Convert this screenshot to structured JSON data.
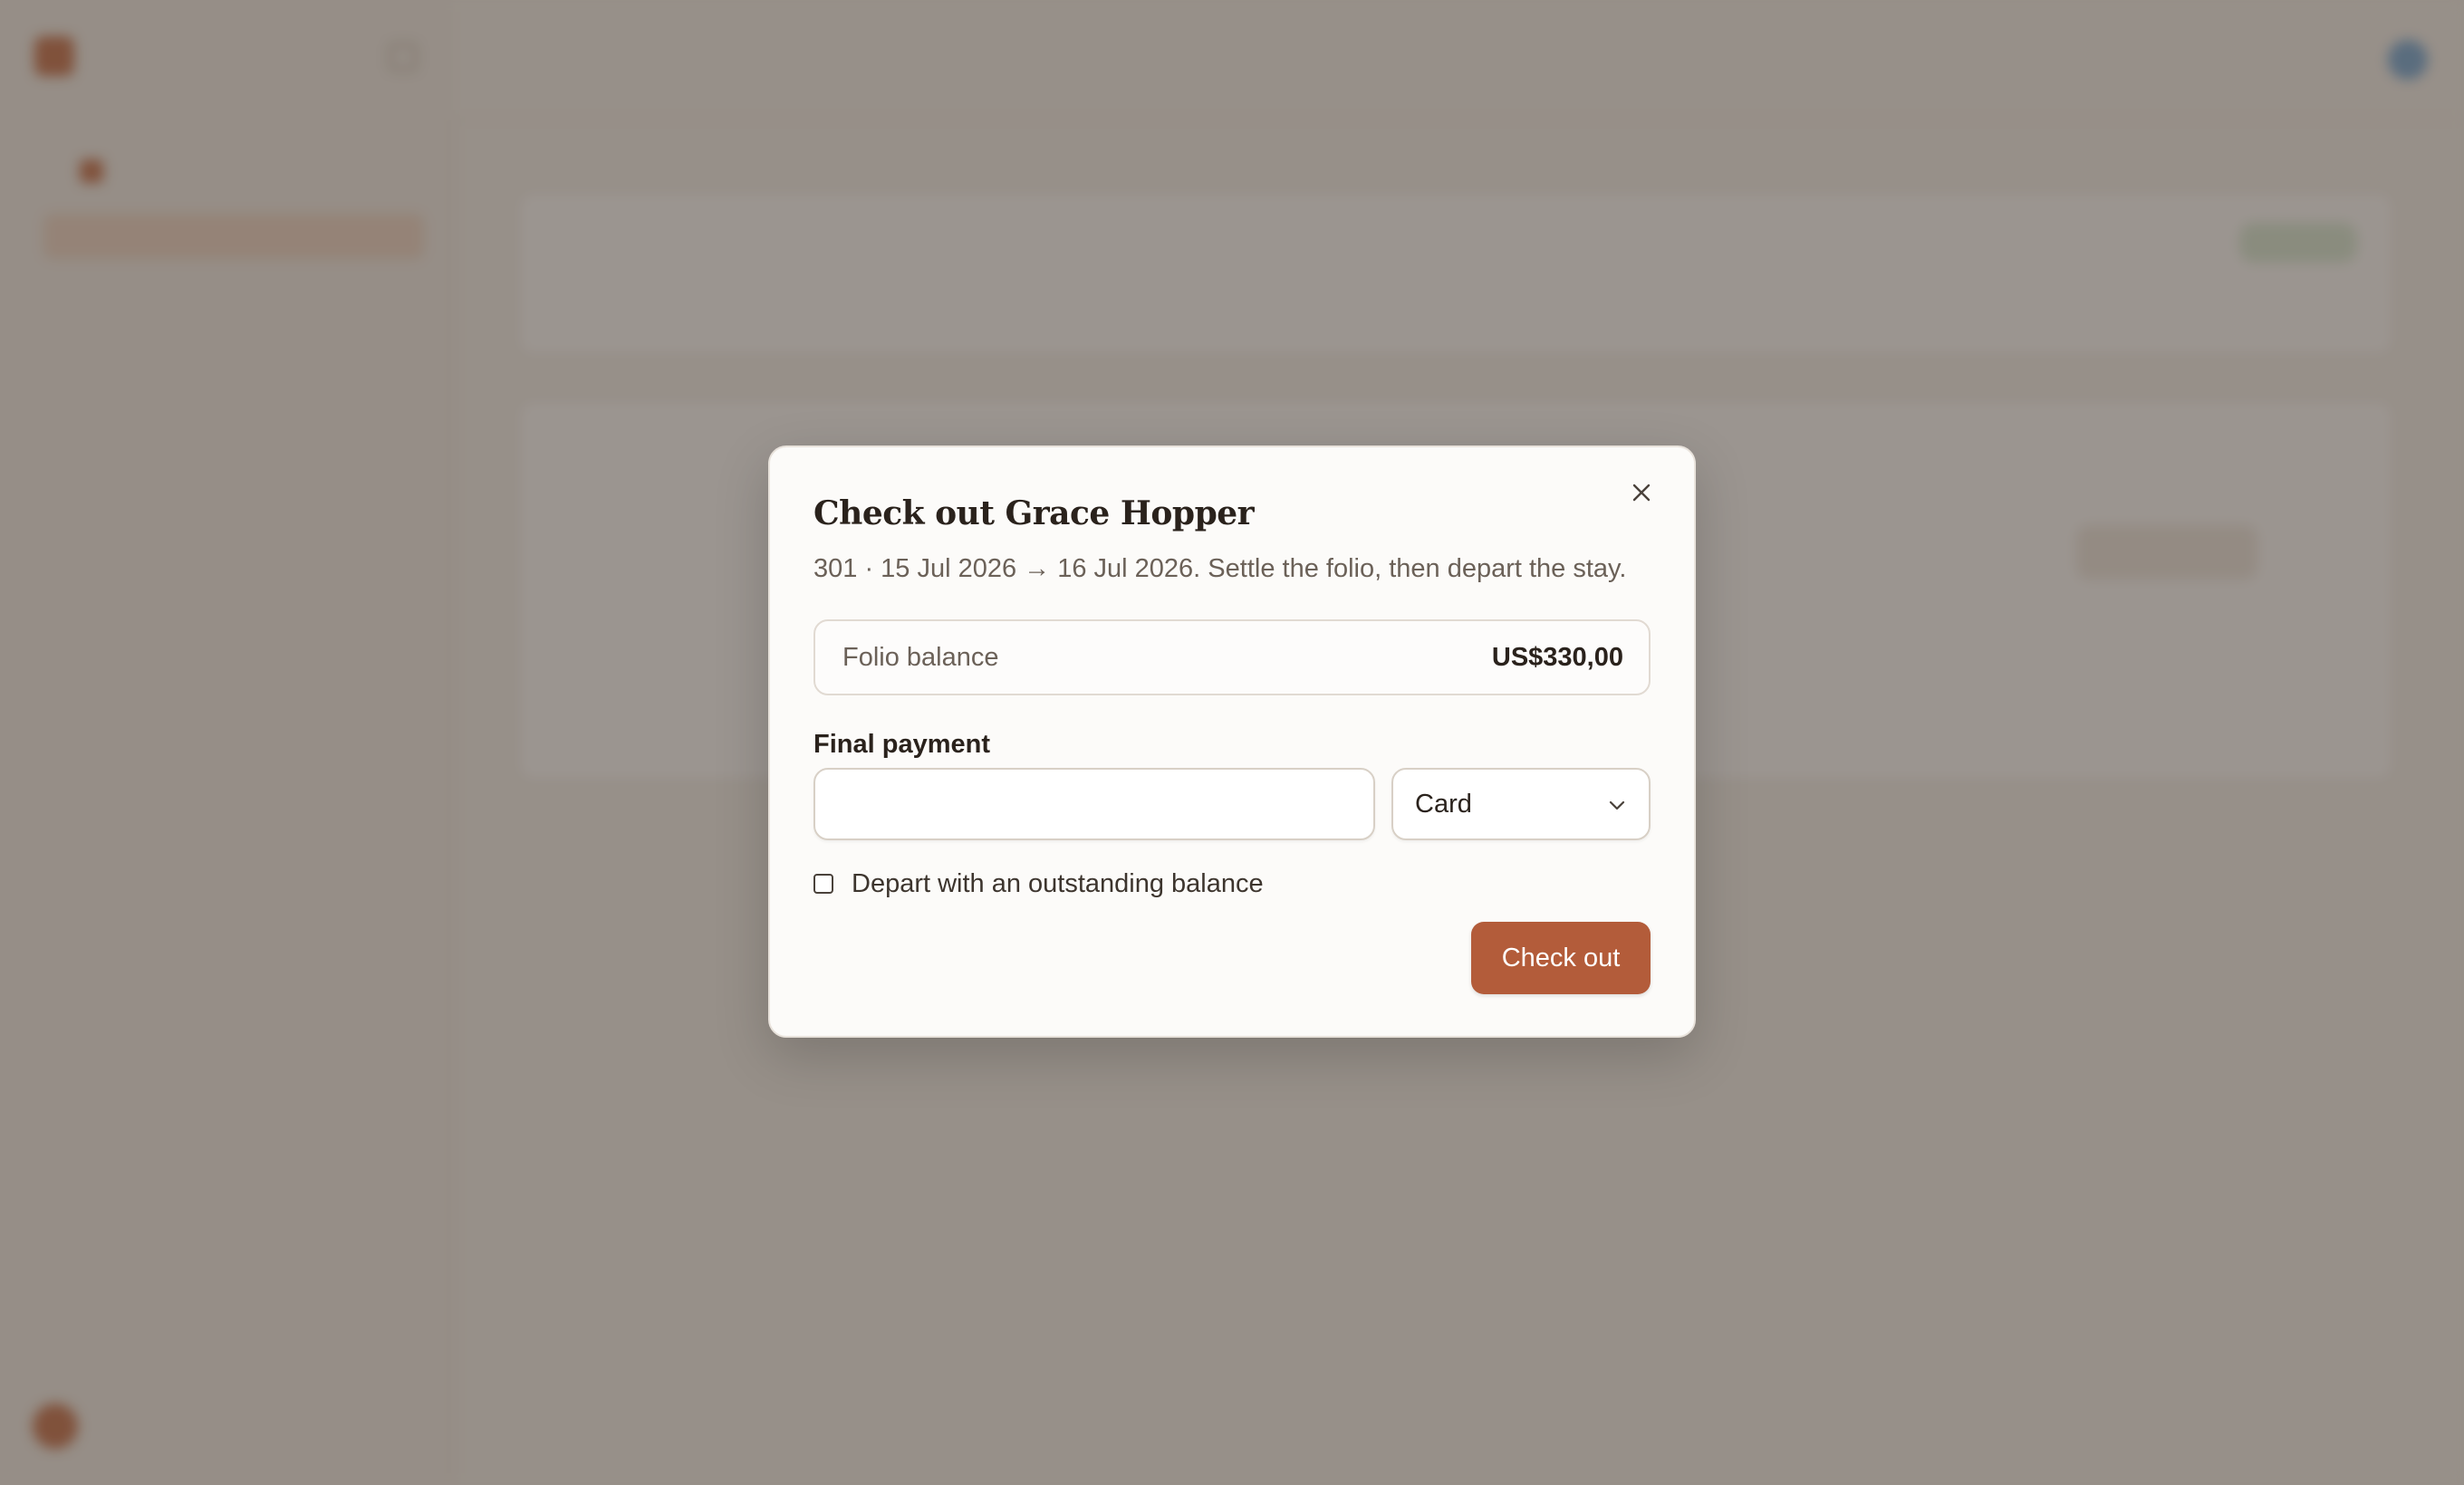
{
  "modal": {
    "title": "Check out Grace Hopper",
    "description": "301 · 15 Jul 2026 → 16 Jul 2026. Settle the folio, then depart the stay.",
    "close_icon": "close-icon",
    "folio_balance": {
      "label": "Folio balance",
      "value": "US$330,00"
    },
    "final_payment": {
      "label": "Final payment",
      "value": "",
      "placeholder": "",
      "method": "Card",
      "method_icon": "chevron-down-icon"
    },
    "outstanding_checkbox": {
      "label": "Depart with an outstanding balance",
      "checked": false
    },
    "submit_label": "Check out"
  },
  "colors": {
    "accent": "#b35c3a",
    "scrim": "rgba(72, 62, 52, 0.55)"
  }
}
